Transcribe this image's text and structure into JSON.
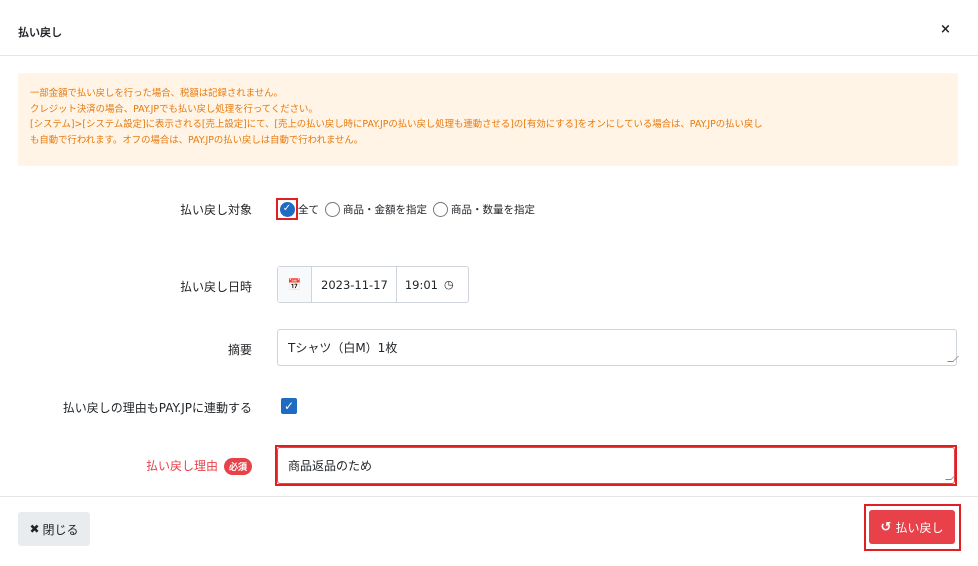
{
  "modal": {
    "title": "払い戻し",
    "close_glyph": "×"
  },
  "alert": {
    "lines": [
      "一部金額で払い戻しを行った場合、税額は記録されません。",
      "クレジット決済の場合、PAY.JPでも払い戻し処理を行ってください。",
      "[システム]>[システム設定]に表示される[売上設定]にて、[売上の払い戻し時にPAY.JPの払い戻し処理も連動させる]の[有効にする]をオンにしている場合は、PAY.JPの払い戻し",
      "も自動で行われます。オフの場合は、PAY.JPの払い戻しは自動で行われません。"
    ]
  },
  "form": {
    "target": {
      "label": "払い戻し対象",
      "options": [
        "全て",
        "商品・金額を指定",
        "商品・数量を指定"
      ],
      "selected": "全て"
    },
    "datetime": {
      "label": "払い戻し日時",
      "date": "2023-11-17",
      "time": "19:01",
      "calendar_icon": "calendar-icon",
      "clock_icon": "clock-icon"
    },
    "summary": {
      "label": "摘要",
      "value": "Tシャツ（白M）1枚"
    },
    "sync_reason": {
      "label": "払い戻しの理由もPAY.JPに連動する",
      "checked": true
    },
    "reason": {
      "label": "払い戻し理由",
      "badge": "必須",
      "value": "商品返品のため"
    }
  },
  "footer": {
    "close_glyph": "✖",
    "close_label": "閉じる",
    "refund_icon": "↺",
    "refund_label": "払い戻し"
  },
  "colors": {
    "accent_red": "#e8414a",
    "highlight_red": "#e02020",
    "alert_bg": "#fff4e5",
    "alert_text": "#e8790c",
    "primary_blue": "#1e6bc2"
  }
}
